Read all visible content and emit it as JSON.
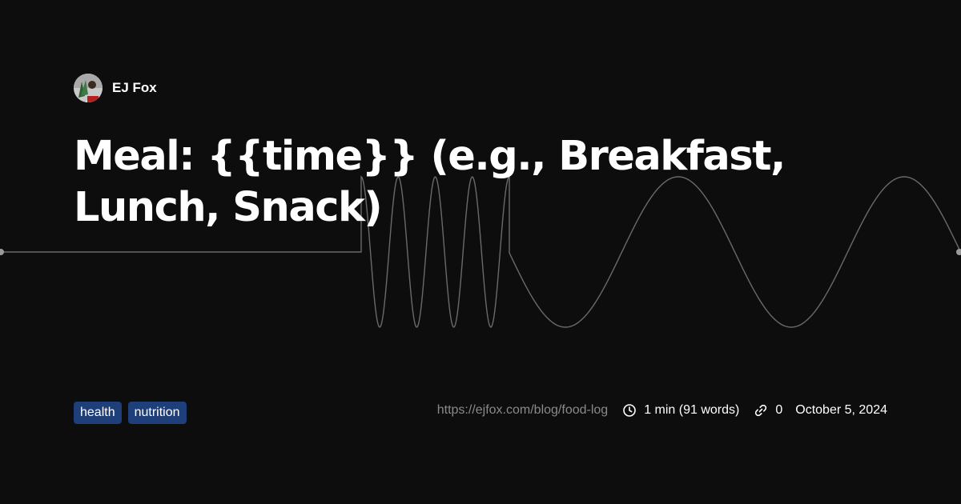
{
  "author": {
    "name": "EJ Fox",
    "avatar_icon": "avatar-photo"
  },
  "post": {
    "title": "Meal: {{time}} (e.g., Breakfast, Lunch, Snack)"
  },
  "tags": [
    "health",
    "nutrition"
  ],
  "meta": {
    "url": "https://ejfox.com/blog/food-log",
    "reading_time": "1 min (91 words)",
    "reading_time_icon": "clock-icon",
    "backlinks": "0",
    "backlinks_icon": "link-icon",
    "date": "October 5, 2024"
  },
  "colors": {
    "background": "#0d0d0d",
    "text": "#ffffff",
    "muted": "#8a8a8a",
    "tag_bg": "#1e3f7a",
    "wave": "#6a6a6a"
  }
}
